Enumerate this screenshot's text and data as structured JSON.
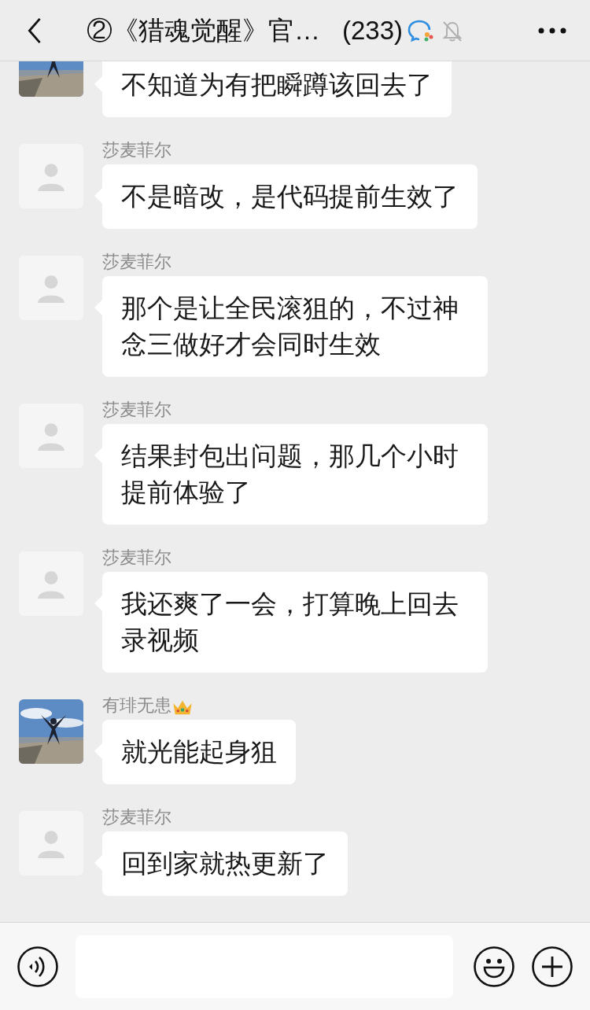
{
  "header": {
    "title": "②《猎魂觉醒》官…",
    "member_count": "(233)",
    "muted": true
  },
  "messages": [
    {
      "text": "不知道为有把瞬蹲该回去了"
    },
    {
      "kind": "default",
      "name": "莎麦菲尔",
      "text": "不是暗改，是代码提前生效了"
    },
    {
      "kind": "default",
      "name": "莎麦菲尔",
      "text": "那个是让全民滚狙的，不过神念三做好才会同时生效"
    },
    {
      "kind": "default",
      "name": "莎麦菲尔",
      "text": "结果封包出问题，那几个小时提前体验了"
    },
    {
      "kind": "default",
      "name": "莎麦菲尔",
      "text": "我还爽了一会，打算晚上回去录视频"
    },
    {
      "name": "有琲无患",
      "crown": true,
      "text": "就光能起身狙"
    },
    {
      "kind": "default",
      "name": "莎麦菲尔",
      "text": "回到家就热更新了"
    }
  ]
}
